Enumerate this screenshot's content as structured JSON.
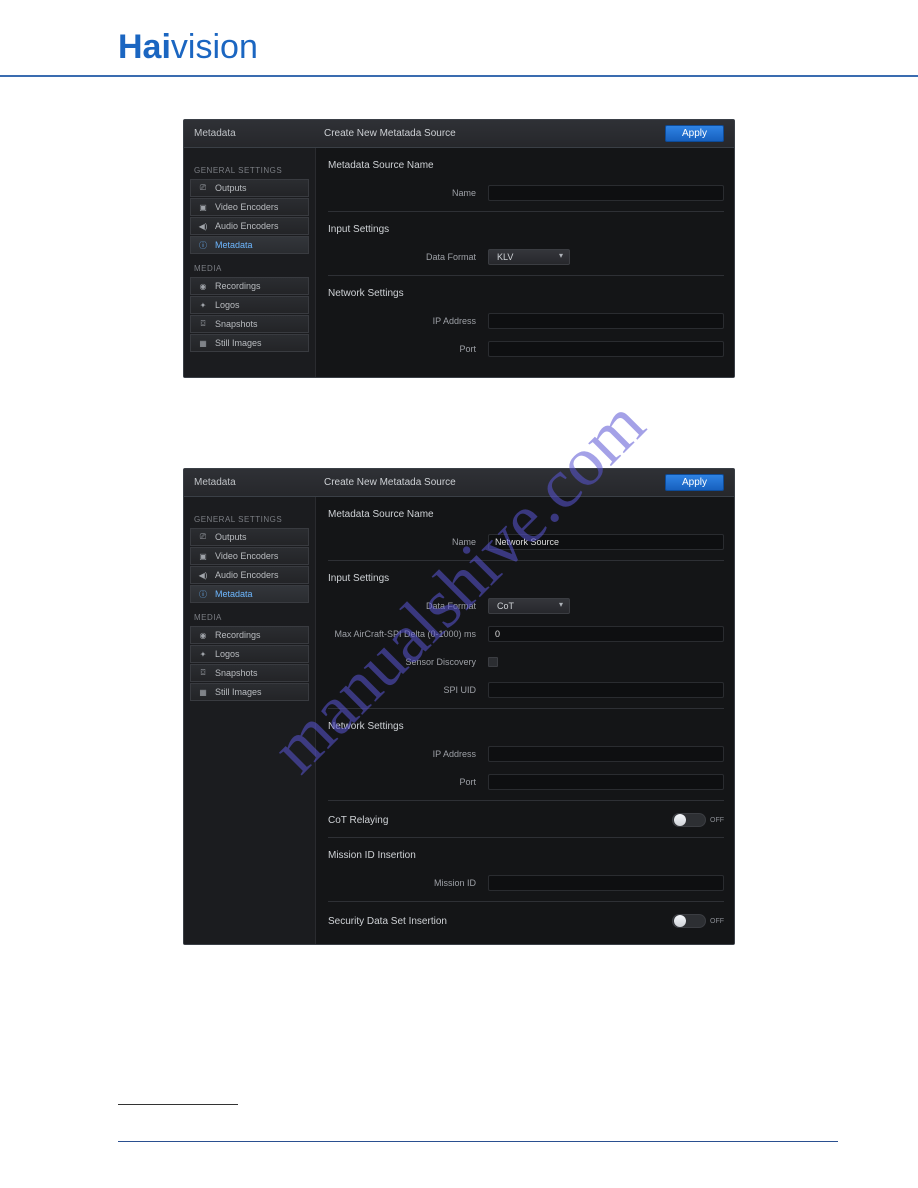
{
  "brand": {
    "part1": "Hai",
    "part2": "vision"
  },
  "watermark": "manualshive.com",
  "screenshot1": {
    "header": {
      "title": "Metadata",
      "subtitle": "Create New Metatada Source",
      "apply": "Apply"
    },
    "sidebar": {
      "group1_label": "GENERAL SETTINGS",
      "group1": [
        {
          "label": "Outputs",
          "icon": "⎚"
        },
        {
          "label": "Video Encoders",
          "icon": "▣"
        },
        {
          "label": "Audio Encoders",
          "icon": "◀)"
        },
        {
          "label": "Metadata",
          "icon": "ⓘ",
          "active": true
        }
      ],
      "group2_label": "MEDIA",
      "group2": [
        {
          "label": "Recordings",
          "icon": "◉"
        },
        {
          "label": "Logos",
          "icon": "✦"
        },
        {
          "label": "Snapshots",
          "icon": "⌼"
        },
        {
          "label": "Still Images",
          "icon": "▦"
        }
      ]
    },
    "sections": {
      "source_name": {
        "title": "Metadata Source Name",
        "name_label": "Name",
        "name_value": ""
      },
      "input_settings": {
        "title": "Input Settings",
        "format_label": "Data Format",
        "format_value": "KLV"
      },
      "network_settings": {
        "title": "Network Settings",
        "ip_label": "IP Address",
        "ip_value": "",
        "port_label": "Port",
        "port_value": ""
      }
    }
  },
  "screenshot2": {
    "header": {
      "title": "Metadata",
      "subtitle": "Create New Metatada Source",
      "apply": "Apply"
    },
    "sidebar": {
      "group1_label": "GENERAL SETTINGS",
      "group1": [
        {
          "label": "Outputs",
          "icon": "⎚"
        },
        {
          "label": "Video Encoders",
          "icon": "▣"
        },
        {
          "label": "Audio Encoders",
          "icon": "◀)"
        },
        {
          "label": "Metadata",
          "icon": "ⓘ",
          "active": true
        }
      ],
      "group2_label": "MEDIA",
      "group2": [
        {
          "label": "Recordings",
          "icon": "◉"
        },
        {
          "label": "Logos",
          "icon": "✦"
        },
        {
          "label": "Snapshots",
          "icon": "⌼"
        },
        {
          "label": "Still Images",
          "icon": "▦"
        }
      ]
    },
    "sections": {
      "source_name": {
        "title": "Metadata Source Name",
        "name_label": "Name",
        "name_value": "Network Source"
      },
      "input_settings": {
        "title": "Input Settings",
        "format_label": "Data Format",
        "format_value": "CoT",
        "delta_label": "Max AirCraft-SPI Delta (0-1000) ms",
        "delta_value": "0",
        "discovery_label": "Sensor Discovery",
        "spi_label": "SPI UID",
        "spi_value": ""
      },
      "network_settings": {
        "title": "Network Settings",
        "ip_label": "IP Address",
        "ip_value": "",
        "port_label": "Port",
        "port_value": ""
      },
      "cot_relaying": {
        "title": "CoT Relaying",
        "toggle": "OFF"
      },
      "mission": {
        "title": "Mission ID Insertion",
        "id_label": "Mission ID",
        "id_value": ""
      },
      "security": {
        "title": "Security Data Set Insertion",
        "toggle": "OFF"
      }
    }
  }
}
